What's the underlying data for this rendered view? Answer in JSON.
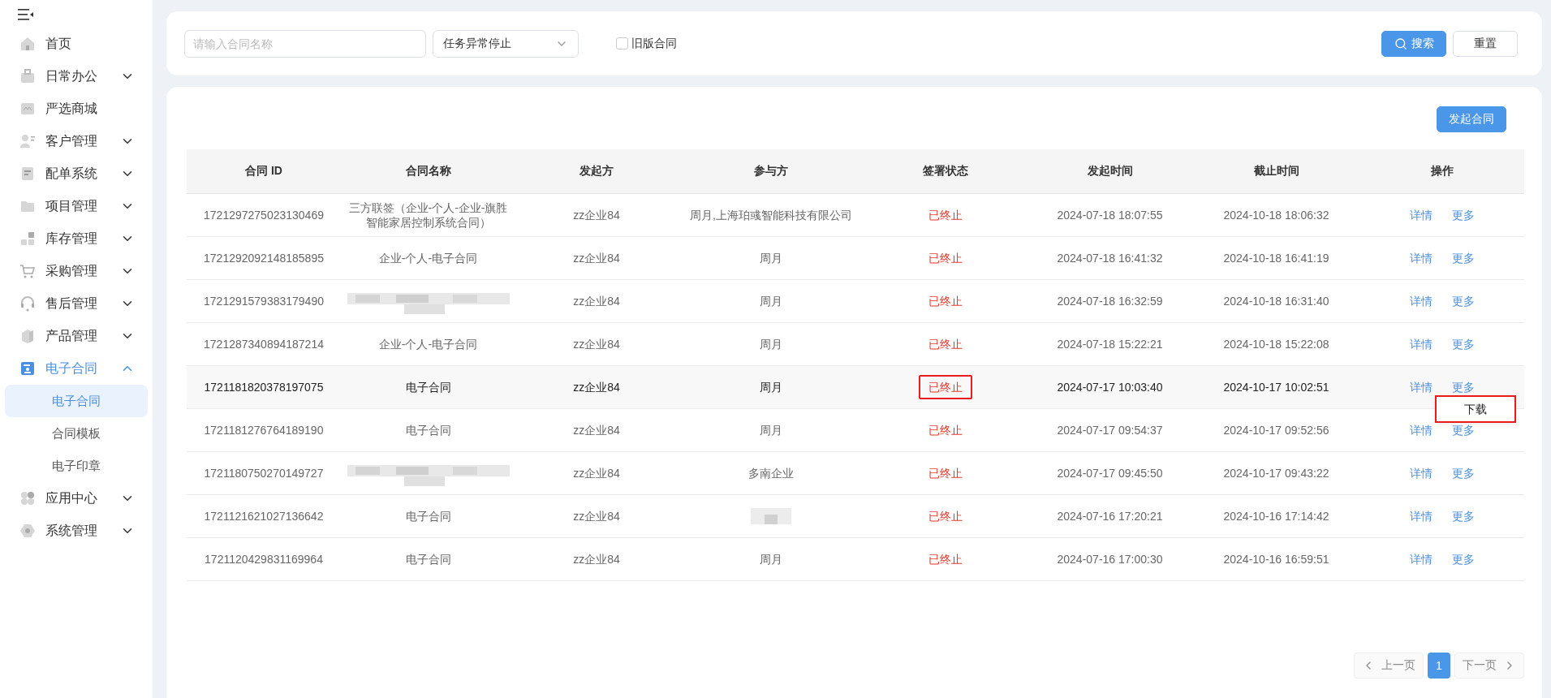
{
  "sidebar": {
    "items": [
      {
        "label": "首页",
        "kind": "link",
        "selected": false
      },
      {
        "label": "日常办公",
        "kind": "group",
        "expanded": false,
        "selected": false
      },
      {
        "label": "严选商城",
        "kind": "link",
        "selected": false
      },
      {
        "label": "客户管理",
        "kind": "group",
        "expanded": false,
        "selected": false
      },
      {
        "label": "配单系统",
        "kind": "group",
        "expanded": false,
        "selected": false
      },
      {
        "label": "项目管理",
        "kind": "group",
        "expanded": false,
        "selected": false
      },
      {
        "label": "库存管理",
        "kind": "group",
        "expanded": false,
        "selected": false
      },
      {
        "label": "采购管理",
        "kind": "group",
        "expanded": false,
        "selected": false
      },
      {
        "label": "售后管理",
        "kind": "group",
        "expanded": false,
        "selected": false
      },
      {
        "label": "产品管理",
        "kind": "group",
        "expanded": false,
        "selected": false
      },
      {
        "label": "电子合同",
        "kind": "group",
        "expanded": true,
        "selected": true,
        "children": [
          {
            "label": "电子合同",
            "selected": true
          },
          {
            "label": "合同模板",
            "selected": false
          },
          {
            "label": "电子印章",
            "selected": false
          }
        ]
      },
      {
        "label": "应用中心",
        "kind": "group",
        "expanded": false,
        "selected": false
      },
      {
        "label": "系统管理",
        "kind": "group",
        "expanded": false,
        "selected": false
      }
    ]
  },
  "filters": {
    "name_field": {
      "placeholder": "请输入合同名称"
    },
    "status_select": {
      "value": "任务异常停止"
    },
    "old_version": {
      "label": "旧版合同",
      "checked": false
    },
    "buttons": [
      {
        "label": "搜索",
        "kind": "primary"
      },
      {
        "label": "重置",
        "kind": "default"
      }
    ]
  },
  "create_button": "发起合同",
  "table": {
    "columns": [
      "合同 ID",
      "合同名称",
      "发起方",
      "参与方",
      "签署状态",
      "发起时间",
      "截止时间",
      "操作"
    ],
    "rows": [
      {
        "id": "1721297275023130469",
        "name": "三方联签（企业-个人-企业-旗胜智能家居控制系统合同）",
        "initiator": "zz企业84",
        "participant": "周月,上海珀彧智能科技有限公司",
        "status": "已终止",
        "start": "2024-07-18 18:07:55",
        "end": "2024-10-18 18:06:32",
        "actions": [
          "详情",
          "更多"
        ],
        "hovered": false
      },
      {
        "id": "1721292092148185895",
        "name": "企业-个人-电子合同",
        "initiator": "zz企业84",
        "participant": "周月",
        "status": "已终止",
        "start": "2024-07-18 16:41:32",
        "end": "2024-10-18 16:41:19",
        "actions": [
          "详情",
          "更多"
        ],
        "hovered": false
      },
      {
        "id": "1721291579383179490",
        "name_blurred": true,
        "initiator": "zz企业84",
        "participant": "周月",
        "status": "已终止",
        "start": "2024-07-18 16:32:59",
        "end": "2024-10-18 16:31:40",
        "actions": [
          "详情",
          "更多"
        ],
        "hovered": false
      },
      {
        "id": "1721287340894187214",
        "name": "企业-个人-电子合同",
        "initiator": "zz企业84",
        "participant": "周月",
        "status": "已终止",
        "start": "2024-07-18 15:22:21",
        "end": "2024-10-18 15:22:08",
        "actions": [
          "详情",
          "更多"
        ],
        "hovered": false
      },
      {
        "id": "1721181820378197075",
        "name": "电子合同",
        "initiator": "zz企业84",
        "participant": "周月",
        "status": "已终止",
        "status_marked": true,
        "start": "2024-07-17 10:03:40",
        "end": "2024-10-17 10:02:51",
        "actions": [
          "详情",
          "更多"
        ],
        "hovered": true,
        "menu": {
          "items": [
            "下载"
          ],
          "marked": true
        }
      },
      {
        "id": "1721181276764189190",
        "name": "电子合同",
        "initiator": "zz企业84",
        "participant": "周月",
        "status": "已终止",
        "start": "2024-07-17 09:54:37",
        "end": "2024-10-17 09:52:56",
        "actions": [
          "详情",
          "更多"
        ],
        "hovered": false
      },
      {
        "id": "1721180750270149727",
        "name_blurred": true,
        "initiator": "zz企业84",
        "participant": "多南企业",
        "status": "已终止",
        "start": "2024-07-17 09:45:50",
        "end": "2024-10-17 09:43:22",
        "actions": [
          "详情",
          "更多"
        ],
        "hovered": false
      },
      {
        "id": "1721121621027136642",
        "name": "电子合同",
        "initiator": "zz企业84",
        "participant_blurred": true,
        "status": "已终止",
        "start": "2024-07-16 17:20:21",
        "end": "2024-10-16 17:14:42",
        "actions": [
          "详情",
          "更多"
        ],
        "hovered": false
      },
      {
        "id": "1721120429831169964",
        "name": "电子合同",
        "initiator": "zz企业84",
        "participant": "周月",
        "status": "已终止",
        "start": "2024-07-16 17:00:30",
        "end": "2024-10-16 16:59:51",
        "actions": [
          "详情",
          "更多"
        ],
        "hovered": false
      }
    ]
  },
  "pagination": {
    "prev": {
      "label": "上一页",
      "disabled": true
    },
    "pages": [
      {
        "label": "1",
        "selected": true
      }
    ],
    "next": {
      "label": "下一页",
      "disabled": true
    }
  }
}
